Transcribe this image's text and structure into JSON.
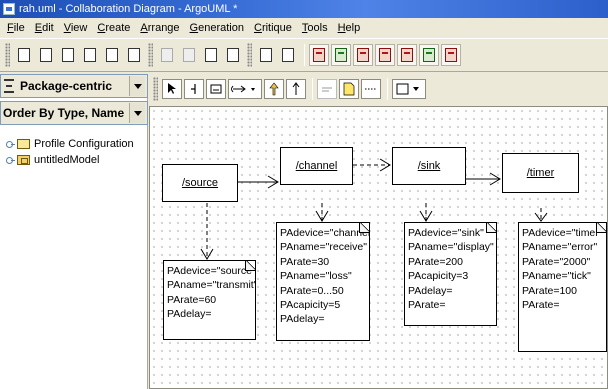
{
  "window": {
    "title": "rah.uml - Collaboration Diagram - ArgoUML *"
  },
  "menu": [
    "File",
    "Edit",
    "View",
    "Create",
    "Arrange",
    "Generation",
    "Critique",
    "Tools",
    "Help"
  ],
  "left_panel": {
    "perspective": "Package-centric",
    "ordering": "Order By Type, Name",
    "tree": [
      {
        "label": "Profile Configuration",
        "icon": "folder-icon"
      },
      {
        "label": "untitledModel",
        "icon": "model-folder-icon"
      }
    ]
  },
  "diagram": {
    "objects": [
      {
        "id": "source",
        "name": "/source"
      },
      {
        "id": "channel",
        "name": "/channel"
      },
      {
        "id": "sink",
        "name": "/sink"
      },
      {
        "id": "timer",
        "name": "/timer"
      }
    ],
    "notes": [
      {
        "id": "note-source",
        "lines": [
          "PAdevice=\"source\"",
          "PAname=\"transmit\"",
          "PArate=60",
          "PAdelay="
        ]
      },
      {
        "id": "note-channel",
        "lines": [
          "PAdevice=\"channel\"",
          "PAname=\"receive\"",
          "PArate=30",
          "PAname=\"loss\"",
          "PArate=0...50",
          "PAcapicity=5",
          "PAdelay="
        ]
      },
      {
        "id": "note-sink",
        "lines": [
          "PAdevice=\"sink\"",
          "PAname=\"display\"",
          "PArate=200",
          "PAcapicity=3",
          "PAdelay=",
          "PArate="
        ]
      },
      {
        "id": "note-timer",
        "lines": [
          "PAdevice=\"timer\"",
          "PAname=\"error\"",
          "PArate=\"2000\"",
          "PAname=\"tick\"",
          "PArate=100",
          "PArate="
        ]
      }
    ]
  },
  "colors": {
    "title_bar": "#3a6fd8",
    "chrome": "#ece9d8",
    "canvas": "#ffffff"
  }
}
